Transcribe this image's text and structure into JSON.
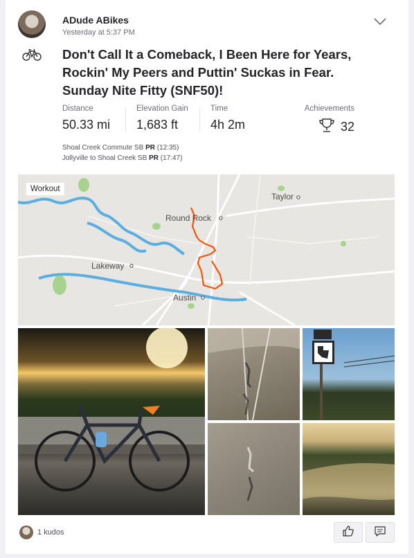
{
  "athlete": {
    "name": "ADude ABikes",
    "timestamp": "Yesterday at 5:37 PM"
  },
  "activity": {
    "sport_icon": "bicycle-icon",
    "title": "Don't Call It a Comeback, I Been Here for Years, Rockin' My Peers and Puttin' Suckas in Fear. Sunday Nite Fitty (SNF50)!"
  },
  "stats": [
    {
      "label": "Distance",
      "value": "50.33 mi"
    },
    {
      "label": "Elevation Gain",
      "value": "1,683 ft"
    },
    {
      "label": "Time",
      "value": "4h 2m"
    }
  ],
  "achievements": {
    "label": "Achievements",
    "value": "32",
    "icon": "trophy-icon"
  },
  "segments": [
    {
      "name": "Shoal Creek Commute SB",
      "badge": "PR",
      "time": "(12:35)"
    },
    {
      "name": "Jollyville to Shoal Creek SB",
      "badge": "PR",
      "time": "(17:47)"
    }
  ],
  "map": {
    "label": "Workout",
    "places": [
      "Taylor",
      "Round Rock",
      "Lakeway",
      "Austin"
    ],
    "route_color": "#fc5200"
  },
  "kudos": {
    "text": "1 kudos"
  },
  "actions": {
    "kudos_icon": "thumbs-up-icon",
    "comment_icon": "comment-icon"
  }
}
